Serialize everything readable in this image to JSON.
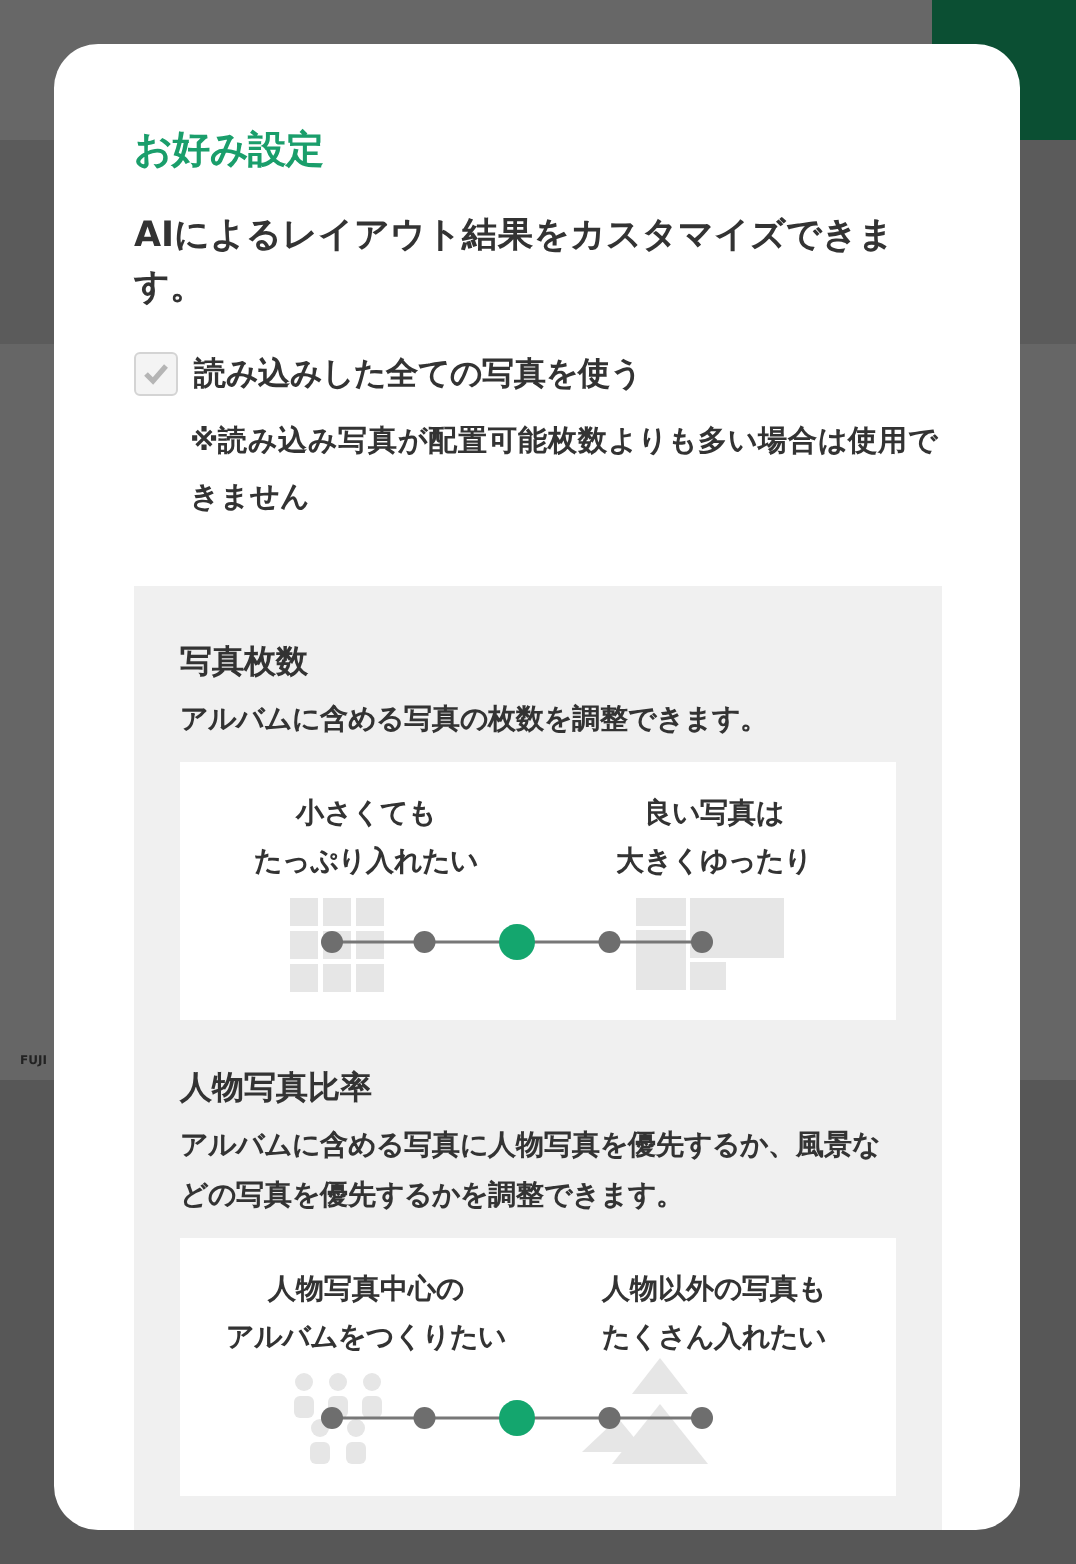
{
  "background": {
    "side_label": "FUJI"
  },
  "dialog": {
    "title": "お好み設定",
    "description": "AIによるレイアウト結果をカスタマイズできます。",
    "checkbox": {
      "label": "読み込みした全ての写真を使う",
      "checked": true,
      "disabled": true
    },
    "note": "※読み込み写真が配置可能枚数よりも多い場合は使用できません",
    "sections": [
      {
        "title": "写真枚数",
        "description": "アルバムに含める写真の枚数を調整できます。",
        "kind": "count",
        "left_label": [
          "小さくても",
          "たっぷり入れたい"
        ],
        "right_label": [
          "良い写真は",
          "大きくゆったり"
        ],
        "level": 0.5
      },
      {
        "title": "人物写真比率",
        "description": "アルバムに含める写真に人物写真を優先するか、風景などの写真を優先するかを調整できます。",
        "kind": "people",
        "left_label": [
          "人物写真中心の",
          "アルバムをつくりたい"
        ],
        "right_label": [
          "人物以外の写真も",
          "たくさん入れたい"
        ],
        "level": 0.5
      }
    ]
  }
}
